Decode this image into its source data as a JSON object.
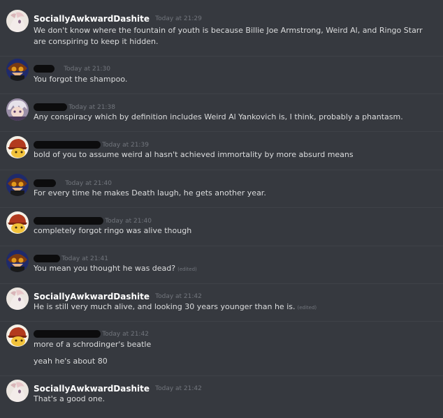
{
  "colors": {
    "background": "#36393f",
    "author": "#ffffff",
    "message_text": "#dcddde",
    "timestamp": "#72767d",
    "redaction": "#0c0c0d"
  },
  "messages": [
    {
      "author": "SociallyAwkwardDashite",
      "timestamp": "Today at 21:29",
      "avatar_icon": "pony-avatar-icon",
      "lines": [
        "We don't know where the fountain of youth is because Billie Joe Armstrong, Weird Al, and Ringo Starr are conspiring to keep it hidden."
      ]
    },
    {
      "author": "",
      "timestamp": "Today at 21:30",
      "avatar_icon": "goggles-avatar-icon",
      "lines": [
        "You forgot the shampoo."
      ]
    },
    {
      "author": "",
      "timestamp": "Today at 21:38",
      "avatar_icon": "silver-hair-avatar-icon",
      "lines": [
        "Any conspiracy which by definition includes Weird Al Yankovich is, I think, probably a phantasm."
      ]
    },
    {
      "author": "",
      "timestamp": "Today at 21:39",
      "avatar_icon": "cap-avatar-icon",
      "lines": [
        "bold of you to assume weird al hasn't achieved immortality by more absurd means"
      ]
    },
    {
      "author": "",
      "timestamp": "Today at 21:40",
      "avatar_icon": "goggles-avatar-icon",
      "lines": [
        "For every time he makes Death laugh, he gets another year."
      ]
    },
    {
      "author": "",
      "timestamp": "Today at 21:40",
      "avatar_icon": "cap-avatar-icon",
      "lines": [
        "completely forgot ringo was alive though"
      ]
    },
    {
      "author": "",
      "timestamp": "Today at 21:41",
      "avatar_icon": "goggles-avatar-icon",
      "lines": [
        "You mean you thought he was dead?"
      ],
      "edited": "(edited)"
    },
    {
      "author": "SociallyAwkwardDashite",
      "timestamp": "Today at 21:42",
      "avatar_icon": "pony-avatar-icon",
      "lines": [
        "He is still very much alive, and looking 30 years younger than he is."
      ],
      "edited": "(edited)"
    },
    {
      "author": "",
      "timestamp": "Today at 21:42",
      "avatar_icon": "cap-avatar-icon",
      "lines": [
        "more of a schrodinger's beatle",
        "yeah he's about 80"
      ]
    },
    {
      "author": "SociallyAwkwardDashite",
      "timestamp": "Today at 21:42",
      "avatar_icon": "pony-avatar-icon",
      "lines": [
        "That's a good one."
      ]
    }
  ]
}
